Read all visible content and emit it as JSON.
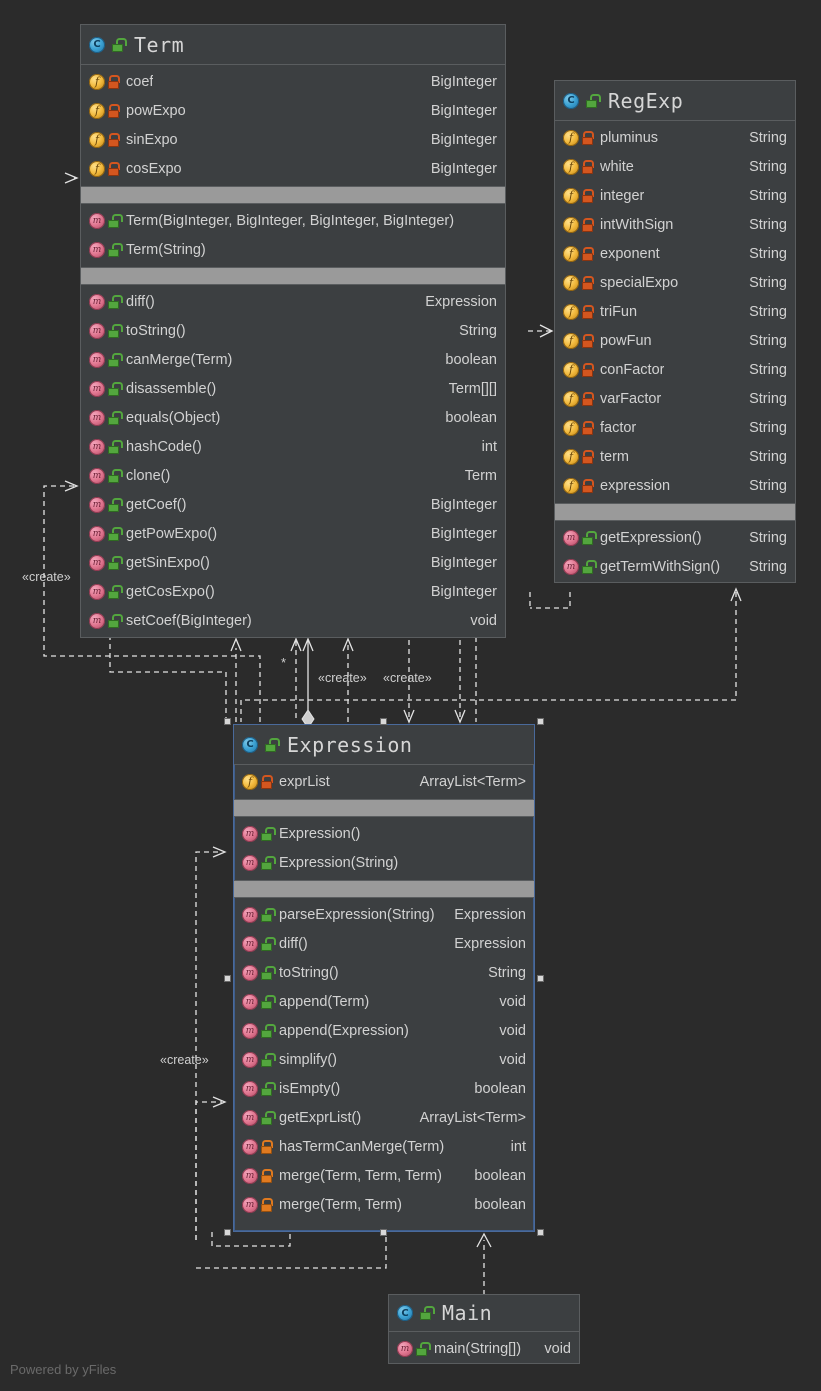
{
  "watermark": "Powered by yFiles",
  "icons": {
    "class": "class-icon",
    "field": "field-icon",
    "method": "method-icon",
    "lock_public": "unlocked-green-icon",
    "lock_private": "locked-red-icon",
    "lock_private_method": "locked-orange-icon"
  },
  "classes": [
    {
      "id": "term",
      "name": "Term",
      "selected": false,
      "fields": [
        {
          "icon": "field-icon",
          "vis": "private",
          "name": "coef",
          "type": "BigInteger"
        },
        {
          "icon": "field-icon",
          "vis": "private",
          "name": "powExpo",
          "type": "BigInteger"
        },
        {
          "icon": "field-icon",
          "vis": "private",
          "name": "sinExpo",
          "type": "BigInteger"
        },
        {
          "icon": "field-icon",
          "vis": "private",
          "name": "cosExpo",
          "type": "BigInteger"
        }
      ],
      "constructors": [
        {
          "icon": "method-icon",
          "vis": "public",
          "name": "Term(BigInteger, BigInteger, BigInteger, BigInteger)",
          "type": ""
        },
        {
          "icon": "method-icon",
          "vis": "public",
          "name": "Term(String)",
          "type": ""
        }
      ],
      "methods": [
        {
          "icon": "method-icon",
          "vis": "public",
          "name": "diff()",
          "type": "Expression"
        },
        {
          "icon": "method-icon",
          "vis": "public",
          "name": "toString()",
          "type": "String"
        },
        {
          "icon": "method-icon",
          "vis": "public",
          "name": "canMerge(Term)",
          "type": "boolean"
        },
        {
          "icon": "method-icon",
          "vis": "public",
          "name": "disassemble()",
          "type": "Term[][]"
        },
        {
          "icon": "method-icon",
          "vis": "public",
          "name": "equals(Object)",
          "type": "boolean"
        },
        {
          "icon": "method-icon",
          "vis": "public",
          "name": "hashCode()",
          "type": "int"
        },
        {
          "icon": "method-icon",
          "vis": "public",
          "name": "clone()",
          "type": "Term"
        },
        {
          "icon": "method-icon",
          "vis": "public",
          "name": "getCoef()",
          "type": "BigInteger"
        },
        {
          "icon": "method-icon",
          "vis": "public",
          "name": "getPowExpo()",
          "type": "BigInteger"
        },
        {
          "icon": "method-icon",
          "vis": "public",
          "name": "getSinExpo()",
          "type": "BigInteger"
        },
        {
          "icon": "method-icon",
          "vis": "public",
          "name": "getCosExpo()",
          "type": "BigInteger"
        },
        {
          "icon": "method-icon",
          "vis": "public",
          "name": "setCoef(BigInteger)",
          "type": "void"
        }
      ]
    },
    {
      "id": "regexp",
      "name": "RegExp",
      "selected": false,
      "fields": [
        {
          "icon": "field-icon",
          "vis": "private",
          "name": "pluminus",
          "type": "String"
        },
        {
          "icon": "field-icon",
          "vis": "private",
          "name": "white",
          "type": "String"
        },
        {
          "icon": "field-icon",
          "vis": "private",
          "name": "integer",
          "type": "String"
        },
        {
          "icon": "field-icon",
          "vis": "private",
          "name": "intWithSign",
          "type": "String"
        },
        {
          "icon": "field-icon",
          "vis": "private",
          "name": "exponent",
          "type": "String"
        },
        {
          "icon": "field-icon",
          "vis": "private",
          "name": "specialExpo",
          "type": "String"
        },
        {
          "icon": "field-icon",
          "vis": "private",
          "name": "triFun",
          "type": "String"
        },
        {
          "icon": "field-icon",
          "vis": "private",
          "name": "powFun",
          "type": "String"
        },
        {
          "icon": "field-icon",
          "vis": "private",
          "name": "conFactor",
          "type": "String"
        },
        {
          "icon": "field-icon",
          "vis": "private",
          "name": "varFactor",
          "type": "String"
        },
        {
          "icon": "field-icon",
          "vis": "private",
          "name": "factor",
          "type": "String"
        },
        {
          "icon": "field-icon",
          "vis": "private",
          "name": "term",
          "type": "String"
        },
        {
          "icon": "field-icon",
          "vis": "private",
          "name": "expression",
          "type": "String"
        }
      ],
      "constructors": [],
      "methods": [
        {
          "icon": "method-icon",
          "vis": "public",
          "name": "getExpression()",
          "type": "String"
        },
        {
          "icon": "method-icon",
          "vis": "public",
          "name": "getTermWithSign()",
          "type": "String"
        }
      ]
    },
    {
      "id": "expression",
      "name": "Expression",
      "selected": true,
      "fields": [
        {
          "icon": "field-icon",
          "vis": "private",
          "name": "exprList",
          "type": "ArrayList<Term>"
        }
      ],
      "constructors": [
        {
          "icon": "method-icon",
          "vis": "public",
          "name": "Expression()",
          "type": ""
        },
        {
          "icon": "method-icon",
          "vis": "public",
          "name": "Expression(String)",
          "type": ""
        }
      ],
      "methods": [
        {
          "icon": "method-icon",
          "vis": "public",
          "name": "parseExpression(String)",
          "type": "Expression"
        },
        {
          "icon": "method-icon",
          "vis": "public",
          "name": "diff()",
          "type": "Expression"
        },
        {
          "icon": "method-icon",
          "vis": "public",
          "name": "toString()",
          "type": "String"
        },
        {
          "icon": "method-icon",
          "vis": "public",
          "name": "append(Term)",
          "type": "void"
        },
        {
          "icon": "method-icon",
          "vis": "public",
          "name": "append(Expression)",
          "type": "void"
        },
        {
          "icon": "method-icon",
          "vis": "public",
          "name": "simplify()",
          "type": "void"
        },
        {
          "icon": "method-icon",
          "vis": "public",
          "name": "isEmpty()",
          "type": "boolean"
        },
        {
          "icon": "method-icon",
          "vis": "public",
          "name": "getExprList()",
          "type": "ArrayList<Term>"
        },
        {
          "icon": "method-icon",
          "vis": "private",
          "name": "hasTermCanMerge(Term)",
          "type": "int"
        },
        {
          "icon": "method-icon",
          "vis": "private",
          "name": "merge(Term, Term, Term)",
          "type": "boolean"
        },
        {
          "icon": "method-icon",
          "vis": "private",
          "name": "merge(Term, Term)",
          "type": "boolean"
        }
      ]
    },
    {
      "id": "main",
      "name": "Main",
      "selected": false,
      "fields": [],
      "constructors": [],
      "methods": [
        {
          "icon": "method-icon",
          "vis": "public",
          "name": "main(String[])",
          "type": "void"
        }
      ]
    }
  ],
  "edge_labels": [
    {
      "id": "create-term-left",
      "text": "«create»"
    },
    {
      "id": "create-term-a",
      "text": "«create»"
    },
    {
      "id": "create-term-b",
      "text": "«create»"
    },
    {
      "id": "create-expr-left",
      "text": "«create»"
    },
    {
      "id": "multiplicity-star",
      "text": "*"
    }
  ]
}
